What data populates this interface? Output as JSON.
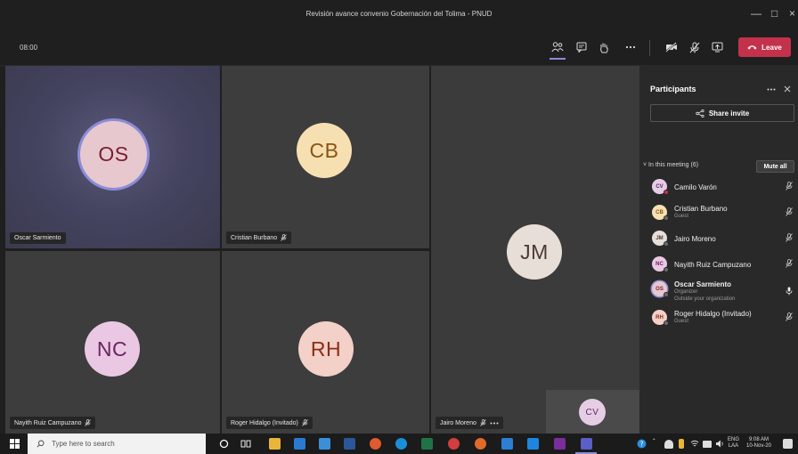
{
  "window": {
    "title": "Revisión avance convenio Gobernación del Tolima - PNUD"
  },
  "toolbar": {
    "timer": "08:00",
    "leave_label": "Leave"
  },
  "tiles": [
    {
      "initials": "OS",
      "name": "Oscar Sarmiento"
    },
    {
      "initials": "CB",
      "name": "Cristian Burbano"
    },
    {
      "initials": "JM",
      "name": "Jairo Moreno"
    },
    {
      "initials": "NC",
      "name": "Nayith Ruiz Campuzano"
    },
    {
      "initials": "RH",
      "name": "Roger Hidalgo (Invitado)"
    },
    {
      "initials": "CV",
      "name": ""
    }
  ],
  "panel": {
    "title": "Participants",
    "share_label": "Share invite",
    "section_label": "In this meeting (6)",
    "mute_all_label": "Mute all",
    "participants": [
      {
        "initials": "CV",
        "name": "Camilo Varón",
        "sub": "",
        "sub2": ""
      },
      {
        "initials": "CB",
        "name": "Cristian Burbano",
        "sub": "Guest",
        "sub2": ""
      },
      {
        "initials": "JM",
        "name": "Jairo Moreno",
        "sub": "",
        "sub2": ""
      },
      {
        "initials": "NC",
        "name": "Nayith Ruiz Campuzano",
        "sub": "",
        "sub2": ""
      },
      {
        "initials": "OS",
        "name": "Oscar Sarmiento",
        "sub": "Organizer",
        "sub2": "Outside your organization"
      },
      {
        "initials": "RH",
        "name": "Roger Hidalgo (Invitado)",
        "sub": "Guest",
        "sub2": ""
      }
    ]
  },
  "taskbar": {
    "search_placeholder": "Type here to search",
    "lang": "ENG",
    "lang2": "LAA",
    "time": "9:08 AM",
    "date": "10-Nov-20"
  },
  "colors": {
    "accent": "#8b8cd8",
    "leave": "#c4314b",
    "avatar_os_bg": "#e7c8ce",
    "avatar_os_fg": "#7a1f2e",
    "avatar_cb_bg": "#f6e0b2",
    "avatar_cb_fg": "#8a5413",
    "avatar_jm_bg": "#e8ded8",
    "avatar_jm_fg": "#4a3b33",
    "avatar_nc_bg": "#eac8e3",
    "avatar_nc_fg": "#6b2360",
    "avatar_rh_bg": "#f3d0c8",
    "avatar_rh_fg": "#8b2e18"
  }
}
